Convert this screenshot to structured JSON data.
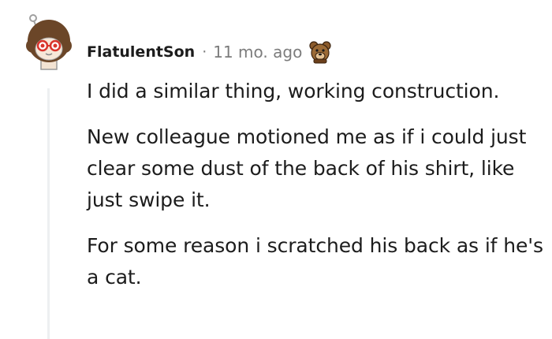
{
  "comment": {
    "author": "FlatulentSon",
    "separator": "·",
    "time": "11 mo. ago",
    "paragraphs": [
      "I did a similar thing, working construction.",
      "New colleague motioned me as if i could just clear some dust of the back of his shirt, like just swipe it.",
      "For some reason i scratched his back as if he's a cat."
    ],
    "avatar_icon": "snoo-avatar-icon",
    "flair_icon": "bear-award-icon"
  },
  "colors": {
    "text": "#1c1c1c",
    "meta": "#7c7c7c",
    "thread_line": "#edeff1"
  }
}
